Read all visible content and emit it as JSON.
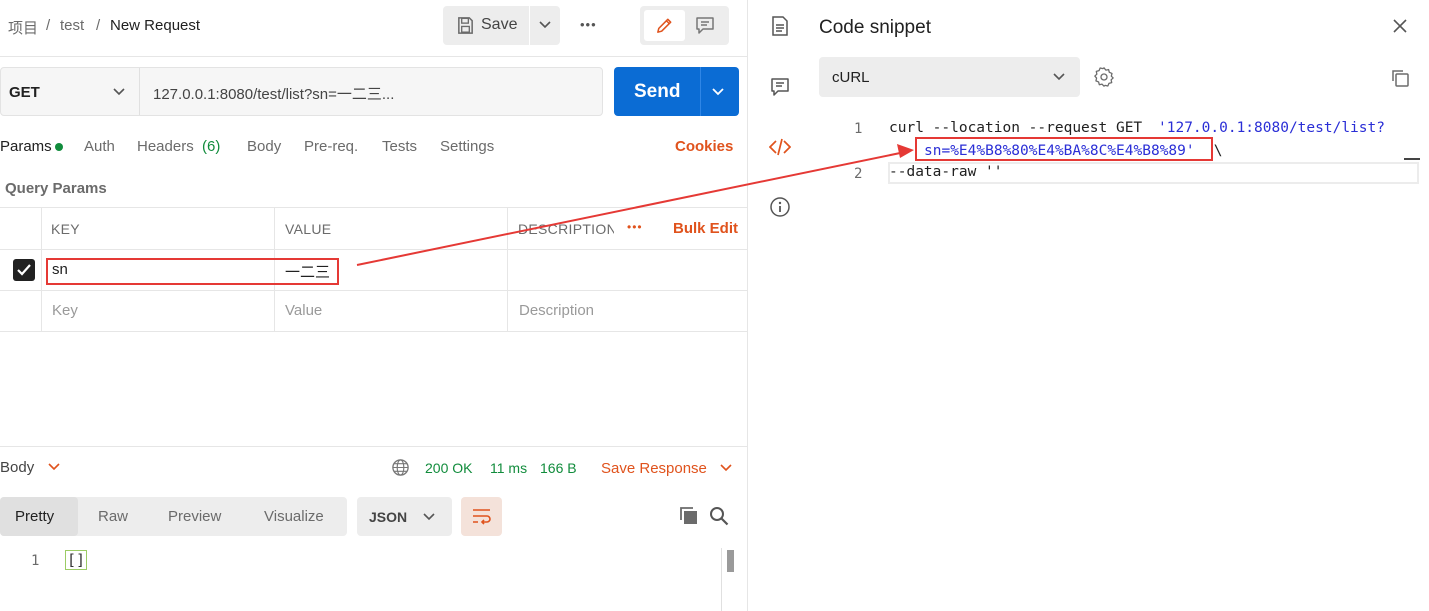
{
  "breadcrumb": {
    "workspace": "项目",
    "sep1": "/",
    "collection": "test",
    "sep2": "/",
    "request": "New Request"
  },
  "toolbar": {
    "save_label": "Save",
    "more_label": "•••"
  },
  "request": {
    "method": "GET",
    "url": "127.0.0.1:8080/test/list?sn=一二三...",
    "send_label": "Send"
  },
  "tabs": {
    "params": "Params",
    "auth": "Auth",
    "headers": "Headers",
    "headers_count": "(6)",
    "body": "Body",
    "prereq": "Pre-req.",
    "tests": "Tests",
    "settings": "Settings",
    "cookies": "Cookies"
  },
  "query_params": {
    "title": "Query Params",
    "col_key": "KEY",
    "col_value": "VALUE",
    "col_desc": "DESCRIPTION",
    "more": "•••",
    "bulk_edit": "Bulk Edit",
    "rows": [
      {
        "key": "sn",
        "value": "一二三",
        "checked": true
      }
    ],
    "placeholder_key": "Key",
    "placeholder_value": "Value",
    "placeholder_desc": "Description"
  },
  "response": {
    "body_label": "Body",
    "status": "200 OK",
    "time": "11 ms",
    "size": "166 B",
    "save_response": "Save Response",
    "view_tabs": [
      "Pretty",
      "Raw",
      "Preview",
      "Visualize"
    ],
    "format": "JSON",
    "line_no": "1",
    "body_text": "[]"
  },
  "snippet": {
    "title": "Code snippet",
    "language": "cURL",
    "line1_no": "1",
    "line1_cmd": "curl --location --request GET ",
    "line1_url": "'127.0.0.1:8080/test/list?",
    "line1_cont": "sn=%E4%B8%80%E4%BA%8C%E4%B8%89'",
    "line1_tail": " \\",
    "line2_no": "2",
    "line2": "--data-raw ''"
  },
  "colors": {
    "accent": "#e0531d",
    "send": "#0b6cd4",
    "status_ok": "#118c3c",
    "annotation": "#e53935",
    "code_string": "#2a2ed6"
  }
}
